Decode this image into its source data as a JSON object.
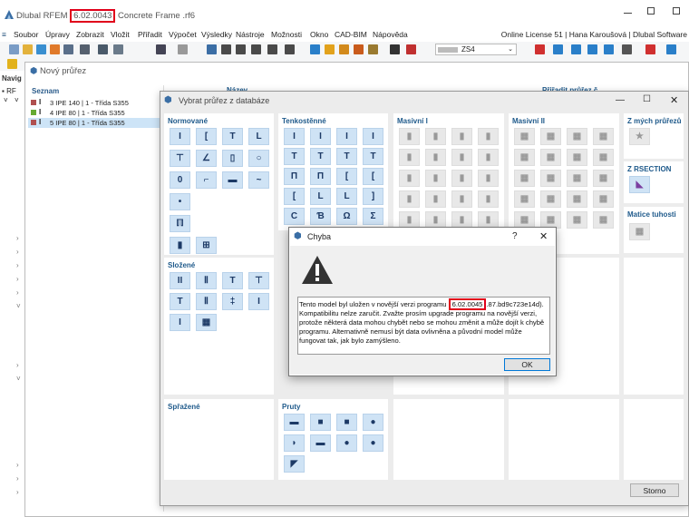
{
  "app": {
    "name": "Dlubal RFEM",
    "version": "6.02.0043",
    "file": "Concrete Frame .rf6"
  },
  "menu": [
    "Soubor",
    "Úpravy",
    "Zobrazit",
    "Vložit",
    "Přiřadit",
    "Výpočet",
    "Výsledky",
    "Nástroje",
    "Možnosti",
    "Okno",
    "CAD-BIM",
    "Nápověda"
  ],
  "license": "Online License 51 | Hana Karoušová | Dlubal Software",
  "toolbar": {
    "combo_value": "ZS4"
  },
  "nav": {
    "header": "Navig",
    "root": "RF"
  },
  "new_section": {
    "title": "Nový průřez",
    "list_header": "Seznam",
    "col_name": "Název",
    "col_assign": "Přiřadit průřez č.",
    "items": [
      {
        "no": "3",
        "label": "IPE 140 | 1 - Třída S355",
        "color": "#b05050"
      },
      {
        "no": "4",
        "label": "IPE 80 | 1 - Třída S355",
        "color": "#66aa33"
      },
      {
        "no": "5",
        "label": "IPE 80 | 1 - Třída S355",
        "color": "#b05050"
      }
    ]
  },
  "db_dialog": {
    "title": "Vybrat průřez z databáze",
    "cat_normovane": "Normované",
    "cat_tenkostenne": "Tenkostěnné",
    "cat_masivni1": "Masivní I",
    "cat_masivni2": "Masivní II",
    "cat_zmych": "Z mých průřezů",
    "cat_rsection": "Z RSECTION",
    "cat_matice": "Matice tuhosti",
    "cat_slozene": "Složené",
    "cat_sprazene": "Spřažené",
    "cat_pruty": "Pruty",
    "cancel": "Storno",
    "glyphs_normovane": [
      "I",
      "[",
      "T",
      "L",
      "⊤",
      "∠",
      "▯",
      "○",
      "0",
      "⌐",
      "▬",
      "~",
      "•",
      "",
      "",
      "",
      "ℿ",
      "",
      "",
      "",
      "▮",
      "⊞"
    ],
    "glyphs_tenko": [
      "I",
      "I",
      "I",
      "I",
      "T",
      "T",
      "T",
      "T",
      "Π",
      "Π",
      "[",
      "[",
      "[",
      "L",
      "L",
      "]",
      "C",
      "Ɓ",
      "Ω",
      "Σ"
    ],
    "glyphs_slozene": [
      "II",
      "Ⅱ",
      "T",
      "⊤",
      "T",
      "Ⅱ",
      "‡",
      "I",
      "I",
      "▦"
    ],
    "glyphs_pruty": [
      "▬",
      "■",
      "■",
      "●",
      "◗",
      "▬",
      "●",
      "●",
      "◤"
    ]
  },
  "error_dialog": {
    "title": "Chyba",
    "help": "?",
    "message_a": "Tento model byl uložen v novější verzi programu ",
    "version": "6.02.0045",
    "message_b": ".87.bd9c723e14d). Kompatibilitu nelze zaručit. Zvažte prosím upgrade programu na novější verzi, protože některá data mohou chybět nebo se mohou změnit a může dojít k chybě programu. Alternativně nemusí být data ovlivněna a původní model může fungovat tak, jak bylo zamýšleno.",
    "ok": "OK"
  }
}
